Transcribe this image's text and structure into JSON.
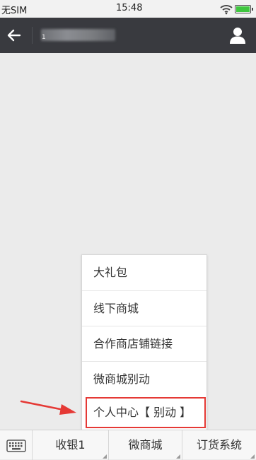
{
  "status_bar": {
    "carrier": "无SIM",
    "time": "15:48",
    "battery_color": "#3fc63f"
  },
  "header": {
    "title": "1",
    "back_icon": "back-arrow-icon",
    "profile_icon": "person-icon",
    "background": "#393a3f"
  },
  "submenu": {
    "items": [
      {
        "label": "大礼包"
      },
      {
        "label": "线下商城"
      },
      {
        "label": "合作商店铺链接"
      },
      {
        "label": "微商城别动"
      },
      {
        "label": "个人中心【 别动 】"
      }
    ],
    "highlight_color": "#e53935"
  },
  "bottom_menu": {
    "keyboard_icon": "keyboard-icon",
    "tabs": [
      {
        "label": "收银1"
      },
      {
        "label": "微商城"
      },
      {
        "label": "订货系统"
      }
    ]
  }
}
